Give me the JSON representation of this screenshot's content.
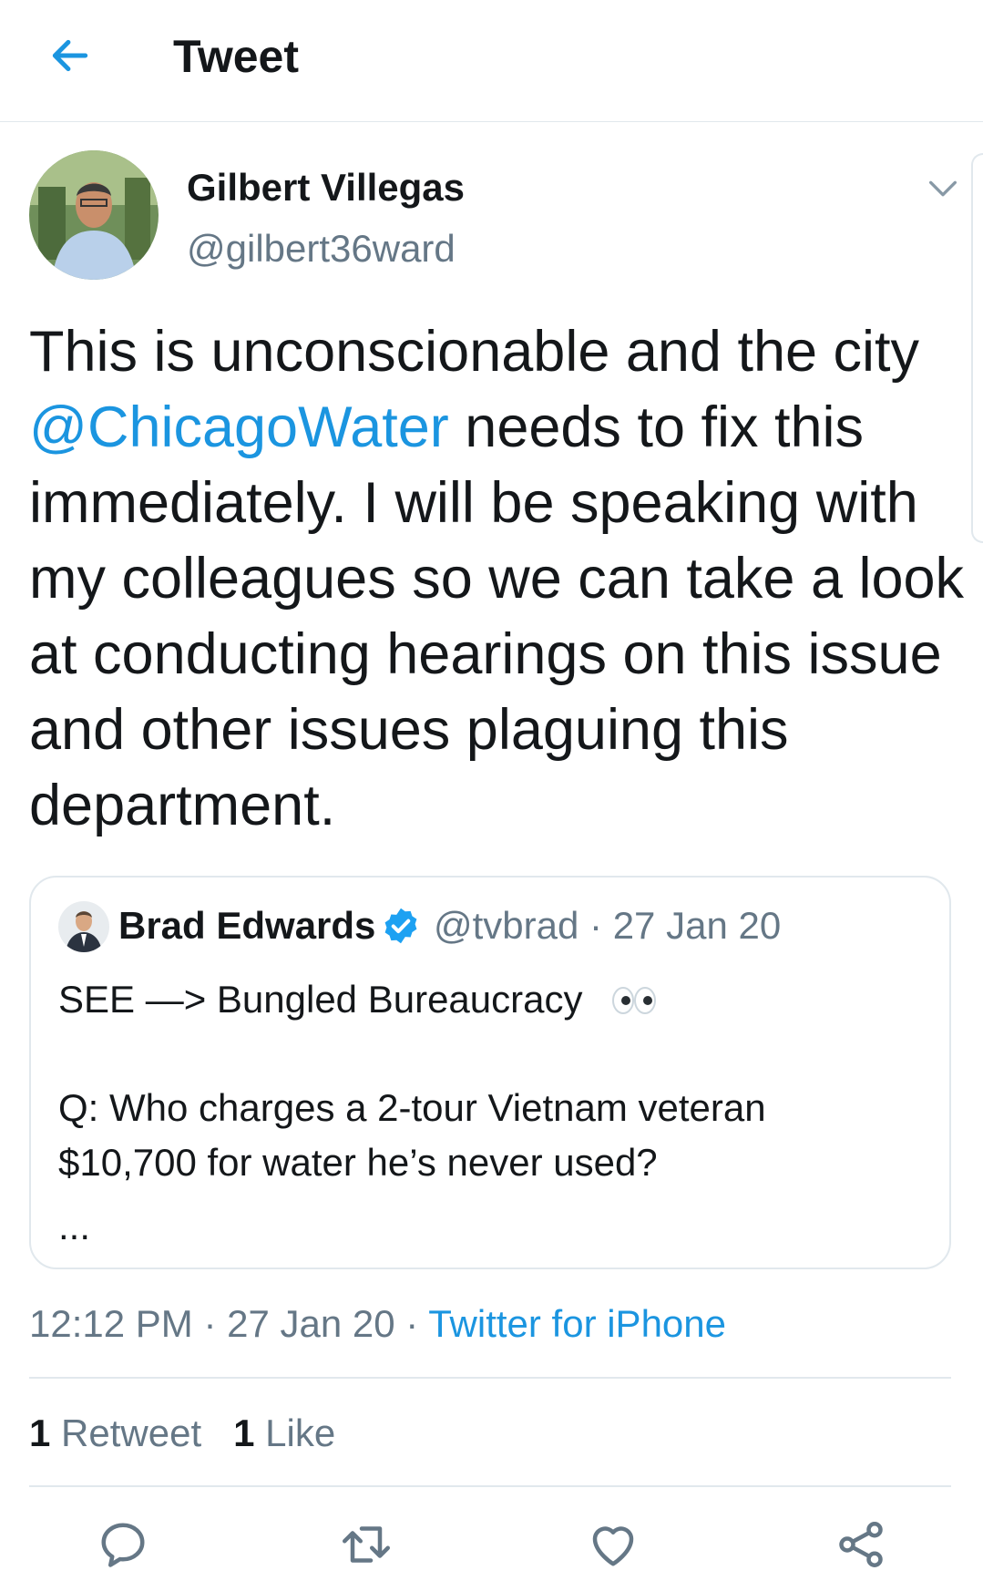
{
  "header": {
    "title": "Tweet",
    "back_icon": "arrow-left-icon",
    "accent": "#1b95e0"
  },
  "tweet": {
    "author_name": "Gilbert Villegas",
    "author_handle": "@gilbert36ward",
    "text_before": "This is unconscionable and the city ",
    "mention": "@ChicagoWater",
    "text_after": " needs to fix this immediately. I will be speaking with my colleagues so we can take a look at conducting hearings on this issue and other issues plaguing this department.",
    "time": "12:12 PM",
    "date": "27 Jan 20",
    "source": "Twitter for iPhone"
  },
  "quote": {
    "author_name": "Brad Edwards",
    "author_handle": "@tvbrad",
    "date": "27 Jan 20",
    "line1": "SEE —> Bungled Bureaucracy",
    "line2": "Q: Who charges a 2-tour Vietnam veteran",
    "line3": "$10,700 for water he’s never used?",
    "ellipsis": "..."
  },
  "stats": {
    "retweet_count": "1",
    "retweet_label": "Retweet",
    "like_count": "1",
    "like_label": "Like"
  },
  "actions": [
    "reply-icon",
    "retweet-icon",
    "like-icon",
    "share-icon"
  ]
}
